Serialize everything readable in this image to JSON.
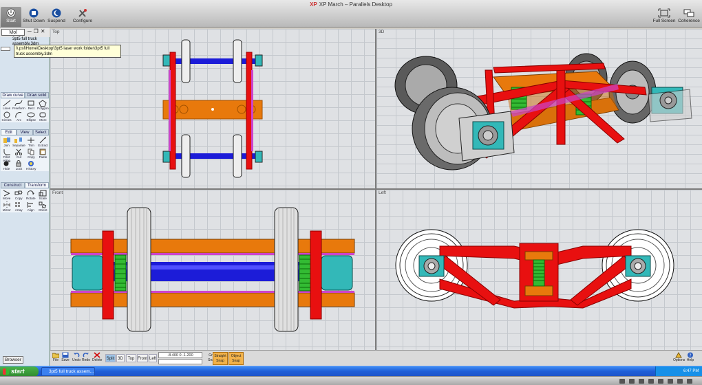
{
  "window": {
    "title": "XP March – Parallels Desktop",
    "xp_badge": "XP"
  },
  "mac_toolbar": {
    "start": "Start",
    "shutdown": "Shut Down",
    "suspend": "Suspend",
    "configure": "Configure",
    "fullscreen": "Full Screen",
    "coherence": "Coherence"
  },
  "command": {
    "layer": "Mol",
    "history_1": "3pt5 full truck",
    "history_2": "assembly.3dm",
    "tooltip": "\\\\.psf\\Home\\Desktop\\3pt5 laser work folder\\3pt5 full truck assembly.3dm"
  },
  "palette": {
    "tabs1": [
      "Draw curve",
      "Draw solid"
    ],
    "draw": [
      "Lines",
      "Freeform",
      "Rect",
      "Polygon",
      "Circles",
      "Arc",
      "Ellipse",
      "More"
    ],
    "tabs2": [
      "Edit",
      "View",
      "Select"
    ],
    "edit": [
      "Join",
      "Separate",
      "Trim",
      "Extract",
      "Fillet edge",
      "Cut",
      "Copy",
      "Paste",
      "Hide",
      "Lock",
      "History"
    ],
    "tabs3": [
      "Construct",
      "Transform"
    ],
    "transform": [
      "Move",
      "Copy",
      "Rotate",
      "Scale",
      "Mirror",
      "Array",
      "Align",
      "Orient"
    ],
    "browser": "Browser"
  },
  "viewports": {
    "top": "Top",
    "persp": "3D",
    "front": "Front",
    "left": "Left"
  },
  "statusbar": {
    "file": "File",
    "save": "Save",
    "undo": "Undo",
    "redo": "Redo",
    "delete": "Delete",
    "views": [
      "Split",
      "3D",
      "Top",
      "Front",
      "Left"
    ],
    "coords": "-8.400    0     -1.200",
    "grid_snap_1": "Grid",
    "grid_snap_2": "Snap",
    "straight_snap_1": "Straight",
    "straight_snap_2": "Snap",
    "object_snap_1": "Object",
    "object_snap_2": "Snap",
    "options": "Options",
    "help": "Help"
  },
  "taskbar": {
    "start": "start",
    "task": "3pt5 full truck assem...",
    "clock": "6:47 PM"
  },
  "colors": {
    "frame": "#e81010",
    "bolster": "#e8790c",
    "axle": "#1c1cd8",
    "spring": "#33bb33",
    "bearing": "#33b8b8",
    "accent": "#cc44cc"
  }
}
